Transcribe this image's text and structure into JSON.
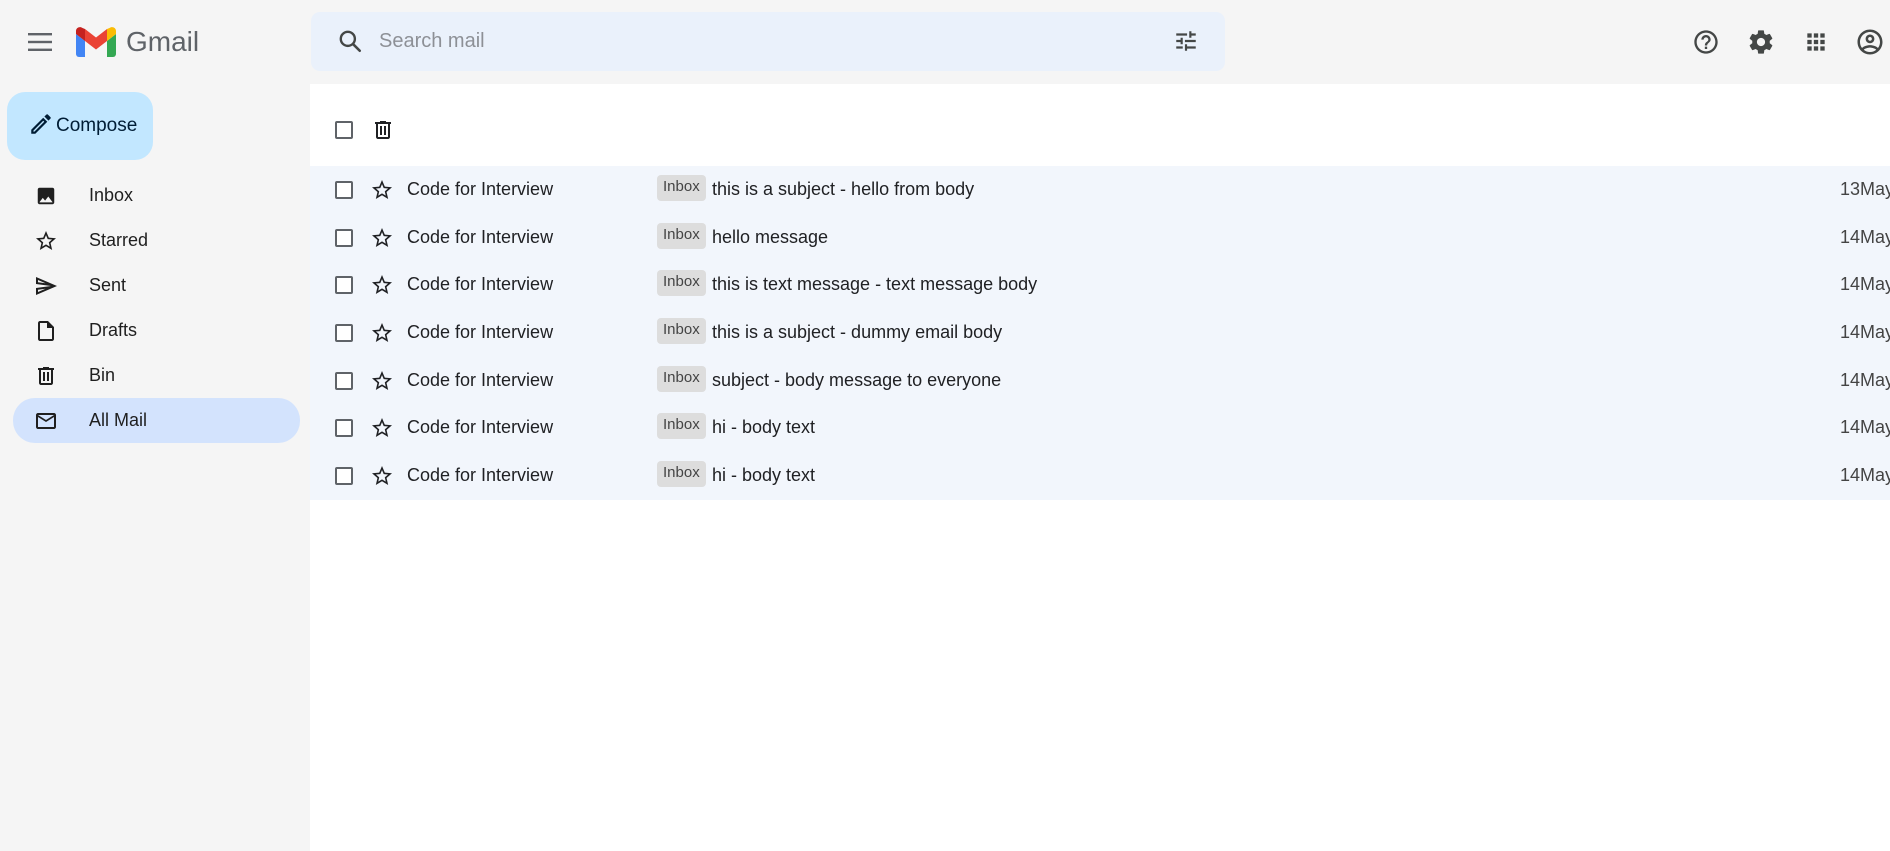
{
  "header": {
    "app_name": "Gmail",
    "search_placeholder": "Search mail"
  },
  "icons": {
    "menu": "menu-icon",
    "search": "search-icon",
    "tune": "tune-icon",
    "help": "help-icon",
    "settings": "gear-icon",
    "apps": "apps-grid-icon",
    "account": "account-circle-icon"
  },
  "colors": {
    "compose_bg": "#c2e7ff",
    "active_nav_bg": "#d3e3fd",
    "search_bg": "#eaf1fb",
    "row_bg": "#f2f6fc"
  },
  "sidebar": {
    "compose_label": "Compose",
    "items": [
      {
        "label": "Inbox",
        "icon": "inbox-icon",
        "active": false
      },
      {
        "label": "Starred",
        "icon": "star-icon",
        "active": false
      },
      {
        "label": "Sent",
        "icon": "send-icon",
        "active": false
      },
      {
        "label": "Drafts",
        "icon": "draft-icon",
        "active": false
      },
      {
        "label": "Bin",
        "icon": "trash-icon",
        "active": false
      },
      {
        "label": "All Mail",
        "icon": "mail-icon",
        "active": true
      }
    ]
  },
  "emails": [
    {
      "sender": "Code for Interview",
      "label": "Inbox",
      "subject": "this is a subject - hello from body",
      "date": "13May"
    },
    {
      "sender": "Code for Interview",
      "label": "Inbox",
      "subject": "hello message",
      "date": "14May"
    },
    {
      "sender": "Code for Interview",
      "label": "Inbox",
      "subject": "this is text message - text message body",
      "date": "14May"
    },
    {
      "sender": "Code for Interview",
      "label": "Inbox",
      "subject": "this is a subject - dummy email body",
      "date": "14May"
    },
    {
      "sender": "Code for Interview",
      "label": "Inbox",
      "subject": "subject - body message to everyone",
      "date": "14May"
    },
    {
      "sender": "Code for Interview",
      "label": "Inbox",
      "subject": "hi - body text",
      "date": "14May"
    },
    {
      "sender": "Code for Interview",
      "label": "Inbox",
      "subject": "hi - body text",
      "date": "14May"
    }
  ]
}
